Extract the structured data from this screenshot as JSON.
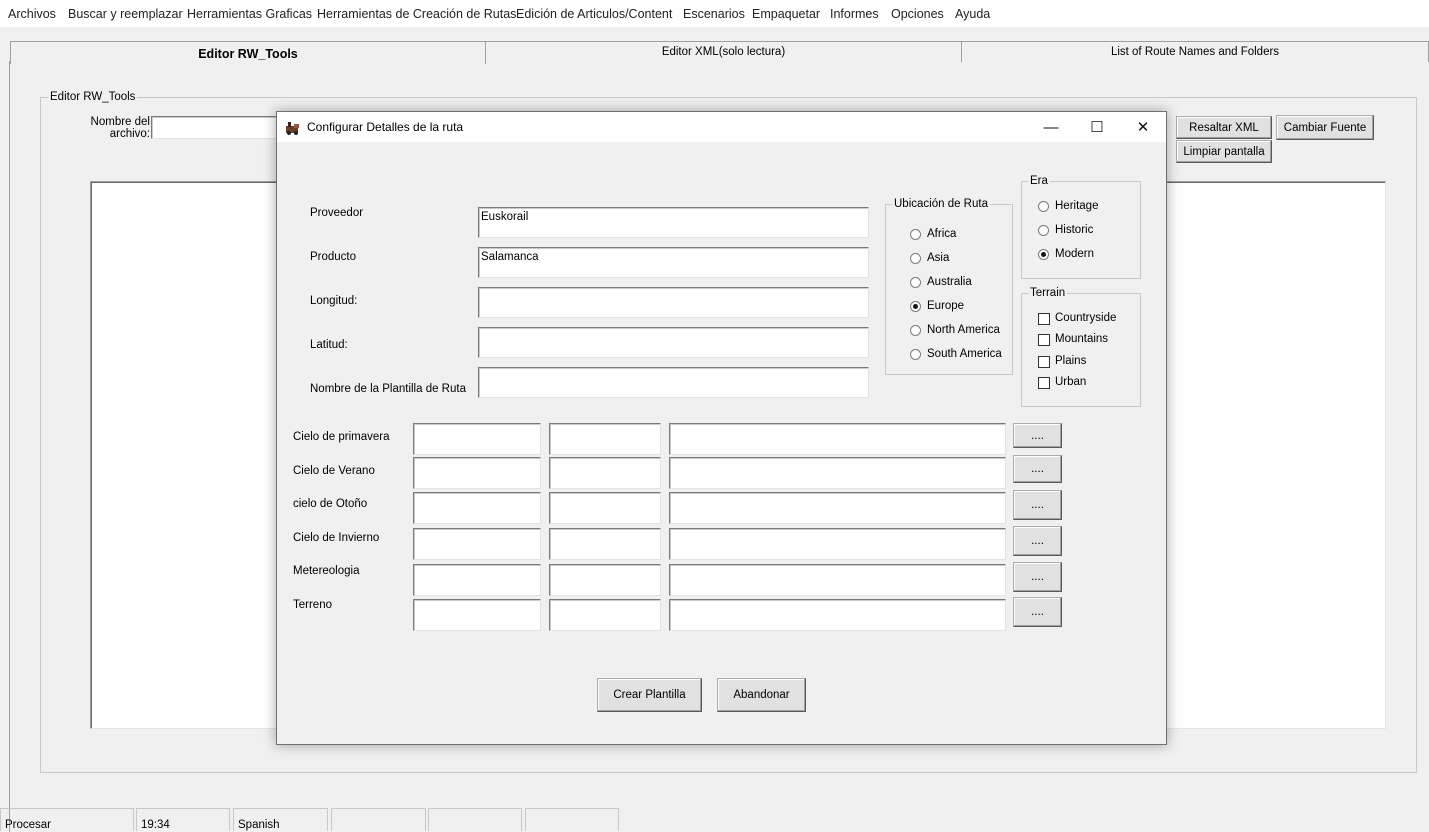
{
  "menubar": {
    "items": [
      "Archivos",
      "Buscar y reemplazar",
      "Herramientas Graficas",
      "Herramientas de Creación de Rutas",
      "Edición de Articulos/Content",
      "Escenarios",
      "Empaquetar",
      "Informes",
      "Opciones",
      "Ayuda"
    ]
  },
  "tabs": [
    "Editor RW_Tools",
    "Editor XML(solo lectura)",
    "List of Route Names and Folders"
  ],
  "editor": {
    "group_label": "Editor RW_Tools",
    "filename_label": "Nombre del archivo:",
    "filename_value": "",
    "highlight_button": "Resaltar XML",
    "font_button": "Cambiar Fuente",
    "clear_button": "Limpiar pantalla"
  },
  "dialog": {
    "title": "Configurar Detalles de la ruta",
    "fields": [
      {
        "label": "Proveedor",
        "value": "Euskorail"
      },
      {
        "label": "Producto",
        "value": "Salamanca"
      },
      {
        "label": "Longitud:",
        "value": ""
      },
      {
        "label": "Latitud:",
        "value": ""
      },
      {
        "label": "Nombre de la Plantilla de Ruta",
        "value": ""
      }
    ],
    "location": {
      "label": "Ubicación de Ruta",
      "options": [
        "Africa",
        "Asia",
        "Australia",
        "Europe",
        "North America",
        "South America"
      ],
      "selected": "Europe"
    },
    "era": {
      "label": "Era",
      "options": [
        "Heritage",
        "Historic",
        "Modern"
      ],
      "selected": "Modern"
    },
    "terrain": {
      "label": "Terrain",
      "options": [
        "Countryside",
        "Mountains",
        "Plains",
        "Urban"
      ],
      "checked": []
    },
    "sky_rows": [
      {
        "label": "Cielo de primavera",
        "browse": "...."
      },
      {
        "label": "Cielo de Verano",
        "browse": "...."
      },
      {
        "label": "cielo de Otoño",
        "browse": "...."
      },
      {
        "label": "Cielo de Invierno",
        "browse": "...."
      },
      {
        "label": "Metereologia",
        "browse": "...."
      },
      {
        "label": "Terreno",
        "browse": "...."
      }
    ],
    "create_button": "Crear Plantilla",
    "cancel_button": "Abandonar"
  },
  "statusbar": [
    "Procesar",
    "19:34",
    "Spanish",
    "",
    "",
    ""
  ]
}
